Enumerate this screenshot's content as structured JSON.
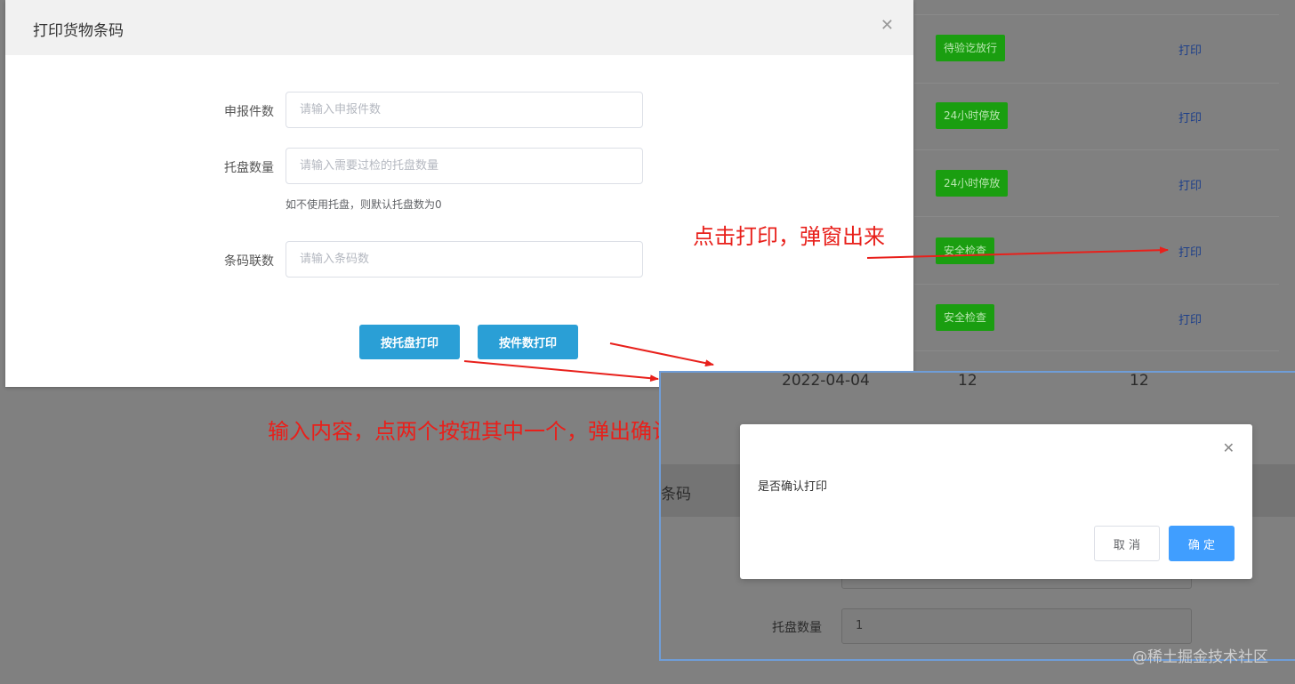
{
  "background_table": {
    "rows": [
      {
        "status": "待验讫放行",
        "action": "打印"
      },
      {
        "status": "24小时停放",
        "action": "打印"
      },
      {
        "status": "24小时停放",
        "action": "打印"
      },
      {
        "status": "安全检查",
        "action": "打印"
      },
      {
        "status": "安全检查",
        "action": "打印"
      }
    ]
  },
  "print_dialog": {
    "title": "打印货物条码",
    "fields": [
      {
        "label": "申报件数",
        "placeholder": "请输入申报件数"
      },
      {
        "label": "托盘数量",
        "placeholder": "请输入需要过检的托盘数量",
        "hint": "如不使用托盘，则默认托盘数为0"
      },
      {
        "label": "条码联数",
        "placeholder": "请输入条码数"
      }
    ],
    "buttons": {
      "by_pallet": "按托盘打印",
      "by_count": "按件数打印"
    }
  },
  "annotations": {
    "click_print": "点击打印，弹窗出来",
    "input_confirm": "输入内容，点两个按钮其中一个，弹出确认框"
  },
  "screenshot_panel": {
    "date": "2022-04-04",
    "num1": "12",
    "num2": "12",
    "header_fragment": "条码",
    "pallet_label": "托盘数量",
    "pallet_value": "1"
  },
  "confirm_dialog": {
    "message": "是否确认打印",
    "cancel_label": "取 消",
    "confirm_label": "确 定"
  },
  "watermark": "@稀土掘金技术社区",
  "colors": {
    "status_green": "#1a9e10",
    "primary_blue": "#2a9fd6",
    "confirm_blue": "#409eff",
    "annotation_red": "#e8201b"
  }
}
